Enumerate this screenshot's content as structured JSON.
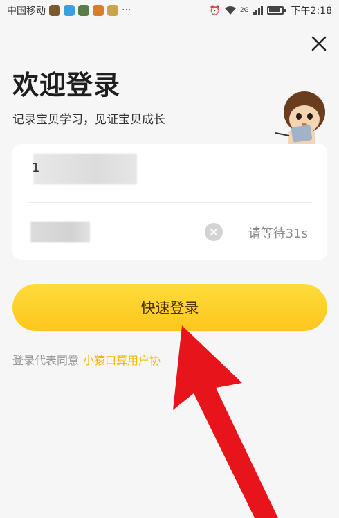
{
  "status_bar": {
    "carrier": "中国移动",
    "more": "···",
    "network": "2G",
    "time": "下午2:18"
  },
  "header": {
    "title": "欢迎登录",
    "subtitle": "记录宝贝学习，见证宝贝成长"
  },
  "form": {
    "phone_prefix": "1",
    "resend_countdown": "请等待31s"
  },
  "login_button": {
    "label": "快速登录"
  },
  "agreement": {
    "prefix": "登录代表同意",
    "link": "小猿口算用户协"
  },
  "colors": {
    "accent": "#FDC61D",
    "link": "#F3B900",
    "arrow": "#E8141B"
  }
}
